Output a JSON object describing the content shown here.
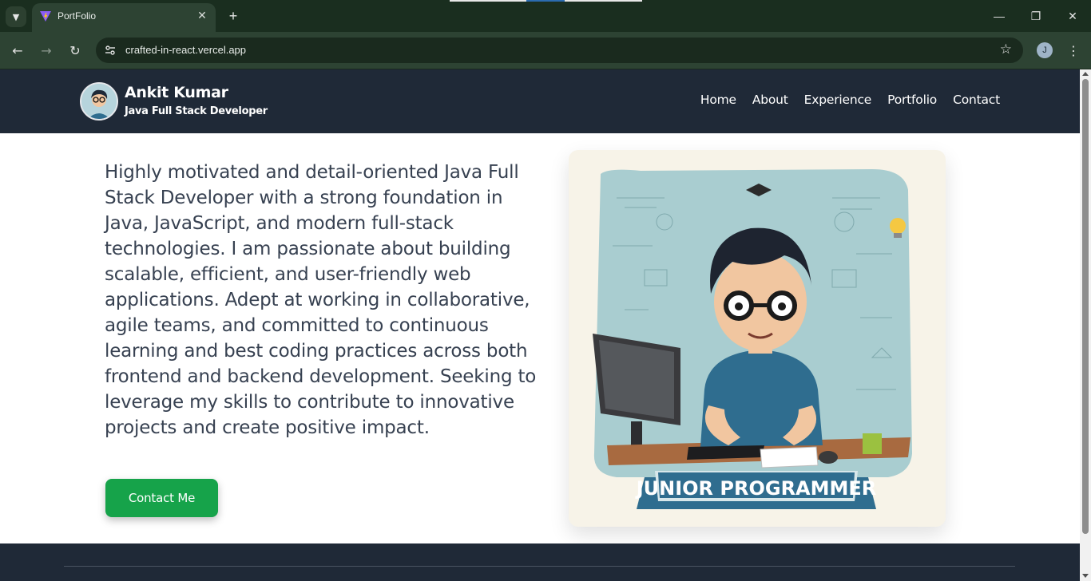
{
  "browser": {
    "tab_title": "PortFolio",
    "url": "crafted-in-react.vercel.app",
    "profile_initial": "J",
    "icons": [
      "tab-search-icon",
      "vite-logo-icon",
      "close-icon",
      "plus-icon",
      "minimize-icon",
      "restore-icon",
      "window-close-icon",
      "back-icon",
      "forward-icon",
      "reload-icon",
      "site-info-icon",
      "star-icon",
      "kebab-menu-icon"
    ]
  },
  "header": {
    "name": "Ankit Kumar",
    "role": "Java Full Stack Developer",
    "nav": [
      "Home",
      "About",
      "Experience",
      "Portfolio",
      "Contact"
    ]
  },
  "hero": {
    "intro": "Highly motivated and detail-oriented Java Full Stack Developer with a strong foundation in Java, JavaScript, and modern full-stack technologies. I am passionate about building scalable, efficient, and user-friendly web applications. Adept at working in collaborative, agile teams, and committed to continuous learning and best coding practices across both frontend and backend development. Seeking to leverage my skills to contribute to innovative projects and create positive impact.",
    "cta_label": "Contact Me",
    "illustration_banner": "JUNIOR PROGRAMMER"
  },
  "colors": {
    "header_bg": "#1f2937",
    "cta_bg": "#16a34a",
    "text": "#374151",
    "browser_chrome": "#2d4333"
  }
}
